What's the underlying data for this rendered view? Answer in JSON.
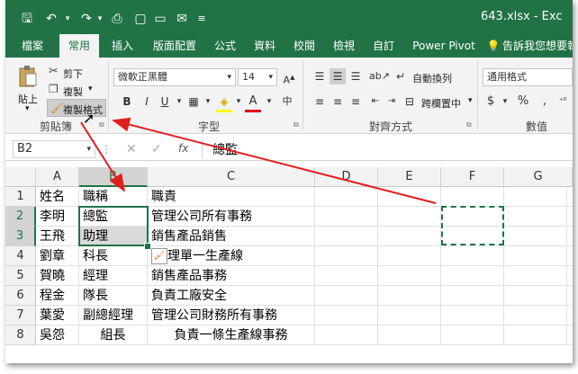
{
  "app": {
    "window_title": "643.xlsx - Exc",
    "quick_access": [
      "save-icon",
      "undo-icon",
      "redo-icon",
      "print-preview-icon",
      "new-icon",
      "open-icon",
      "send-icon",
      "more-icon"
    ]
  },
  "tabs": [
    {
      "label": "檔案"
    },
    {
      "label": "常用",
      "active": true
    },
    {
      "label": "插入"
    },
    {
      "label": "版面配置"
    },
    {
      "label": "公式"
    },
    {
      "label": "資料"
    },
    {
      "label": "校閱"
    },
    {
      "label": "檢視"
    },
    {
      "label": "自訂"
    },
    {
      "label": "Power Pivot"
    },
    {
      "label": "告訴我您想要執"
    }
  ],
  "ribbon": {
    "clipboard": {
      "paste": "貼上",
      "cut": "剪下",
      "copy": "複製",
      "format_painter": "複製格式",
      "group_label": "剪貼簿"
    },
    "font": {
      "font_name": "微軟正黑體",
      "font_size": "14",
      "bold": "B",
      "italic": "I",
      "underline": "U",
      "group_label": "字型"
    },
    "alignment": {
      "wrap_text": "自動換列",
      "merge_center": "跨欄置中",
      "group_label": "對齊方式"
    },
    "number": {
      "format": "通用格式",
      "currency": "$",
      "percent": "%",
      "comma": ",",
      "group_label": "數值"
    }
  },
  "formula_bar": {
    "name_box": "B2",
    "fx": "fx",
    "content": "總監"
  },
  "sheet": {
    "columns": [
      "A",
      "B",
      "C",
      "D",
      "E",
      "F",
      "G"
    ],
    "selected_column": "B",
    "rows": [
      {
        "num": "1",
        "cells": [
          "姓名",
          "職稱",
          "職責"
        ]
      },
      {
        "num": "2",
        "cells": [
          "李明",
          "總監",
          "管理公司所有事務"
        ]
      },
      {
        "num": "3",
        "cells": [
          "王飛",
          "助理",
          "銷售產品銷售"
        ]
      },
      {
        "num": "4",
        "cells": [
          "劉章",
          "科長",
          "理單一生產線"
        ]
      },
      {
        "num": "5",
        "cells": [
          "賀曉",
          "經理",
          "銷售產品事務"
        ]
      },
      {
        "num": "6",
        "cells": [
          "程金",
          "隊長",
          "負責工廠安全"
        ]
      },
      {
        "num": "7",
        "cells": [
          "葉愛",
          "副總經理",
          "管理公司財務所有事務"
        ]
      },
      {
        "num": "8",
        "cells": [
          "吳怨",
          "組長",
          "負責一條生產線事務"
        ]
      }
    ],
    "selected_rows": [
      "2",
      "3"
    ]
  },
  "colors": {
    "brand": "#217346",
    "annotation_arrow": "#e0201e",
    "selection_fill": "#d9d9d9"
  }
}
